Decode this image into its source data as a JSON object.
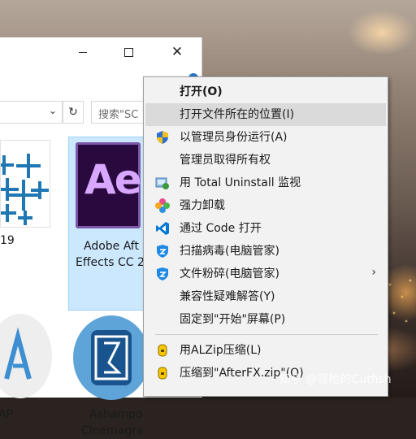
{
  "window": {
    "minimize_glyph": "minimize",
    "maximize_glyph": "maximize",
    "close_label": "✕",
    "refresh_label": "↻",
    "addr_chevron": "⌄",
    "search_placeholder": "搜索\"SC"
  },
  "files": [
    {
      "label_line1": "19",
      "label_line2": "",
      "icon": "tableau-icon"
    },
    {
      "label_line1": "Adobe Aft",
      "label_line2": "Effects CC 2",
      "icon": "after-effects-icon",
      "icon_text": "Ae"
    },
    {
      "label_line1": "AP",
      "label_line2": "",
      "icon": "alzip-app-icon"
    },
    {
      "label_line1": "Ashampo",
      "label_line2": "Cinemagra",
      "icon": "ashampoo-icon"
    }
  ],
  "context_menu": {
    "items": [
      {
        "label": "打开(O)",
        "bold": true,
        "icon": ""
      },
      {
        "label": "打开文件所在的位置(I)",
        "highlighted": true,
        "icon": ""
      },
      {
        "label": "以管理员身份运行(A)",
        "icon": "uac-shield-icon"
      },
      {
        "label": "管理员取得所有权",
        "icon": ""
      },
      {
        "label": "用 Total Uninstall 监视",
        "icon": "total-uninstall-icon"
      },
      {
        "label": "强力卸载",
        "icon": "uninstall-flower-icon"
      },
      {
        "label": "通过 Code 打开",
        "icon": "vscode-icon"
      },
      {
        "label": "扫描病毒(电脑管家)",
        "icon": "tencent-shield-icon"
      },
      {
        "label": "文件粉碎(电脑管家)",
        "icon": "tencent-shield-icon",
        "submenu": true
      },
      {
        "label": "兼容性疑难解答(Y)",
        "icon": ""
      },
      {
        "label": "固定到\"开始\"屏幕(P)",
        "icon": ""
      },
      {
        "label": "用ALZip压缩(L)",
        "icon": "alzip-icon"
      },
      {
        "label": "压缩到\"AfterFX.zip\"(Q)",
        "icon": "alzip-icon"
      }
    ],
    "submenu_arrow": "›"
  },
  "watermark": "知乎 @冒险的Cutfish",
  "colors": {
    "menu_bg": "#f2f2f2",
    "menu_highlight": "#dadada",
    "ae_purple": "#d8a7ff",
    "tableau_blue": "#1f77b4",
    "vscode_blue": "#0078d4",
    "alzip_yellow": "#f6c600"
  }
}
